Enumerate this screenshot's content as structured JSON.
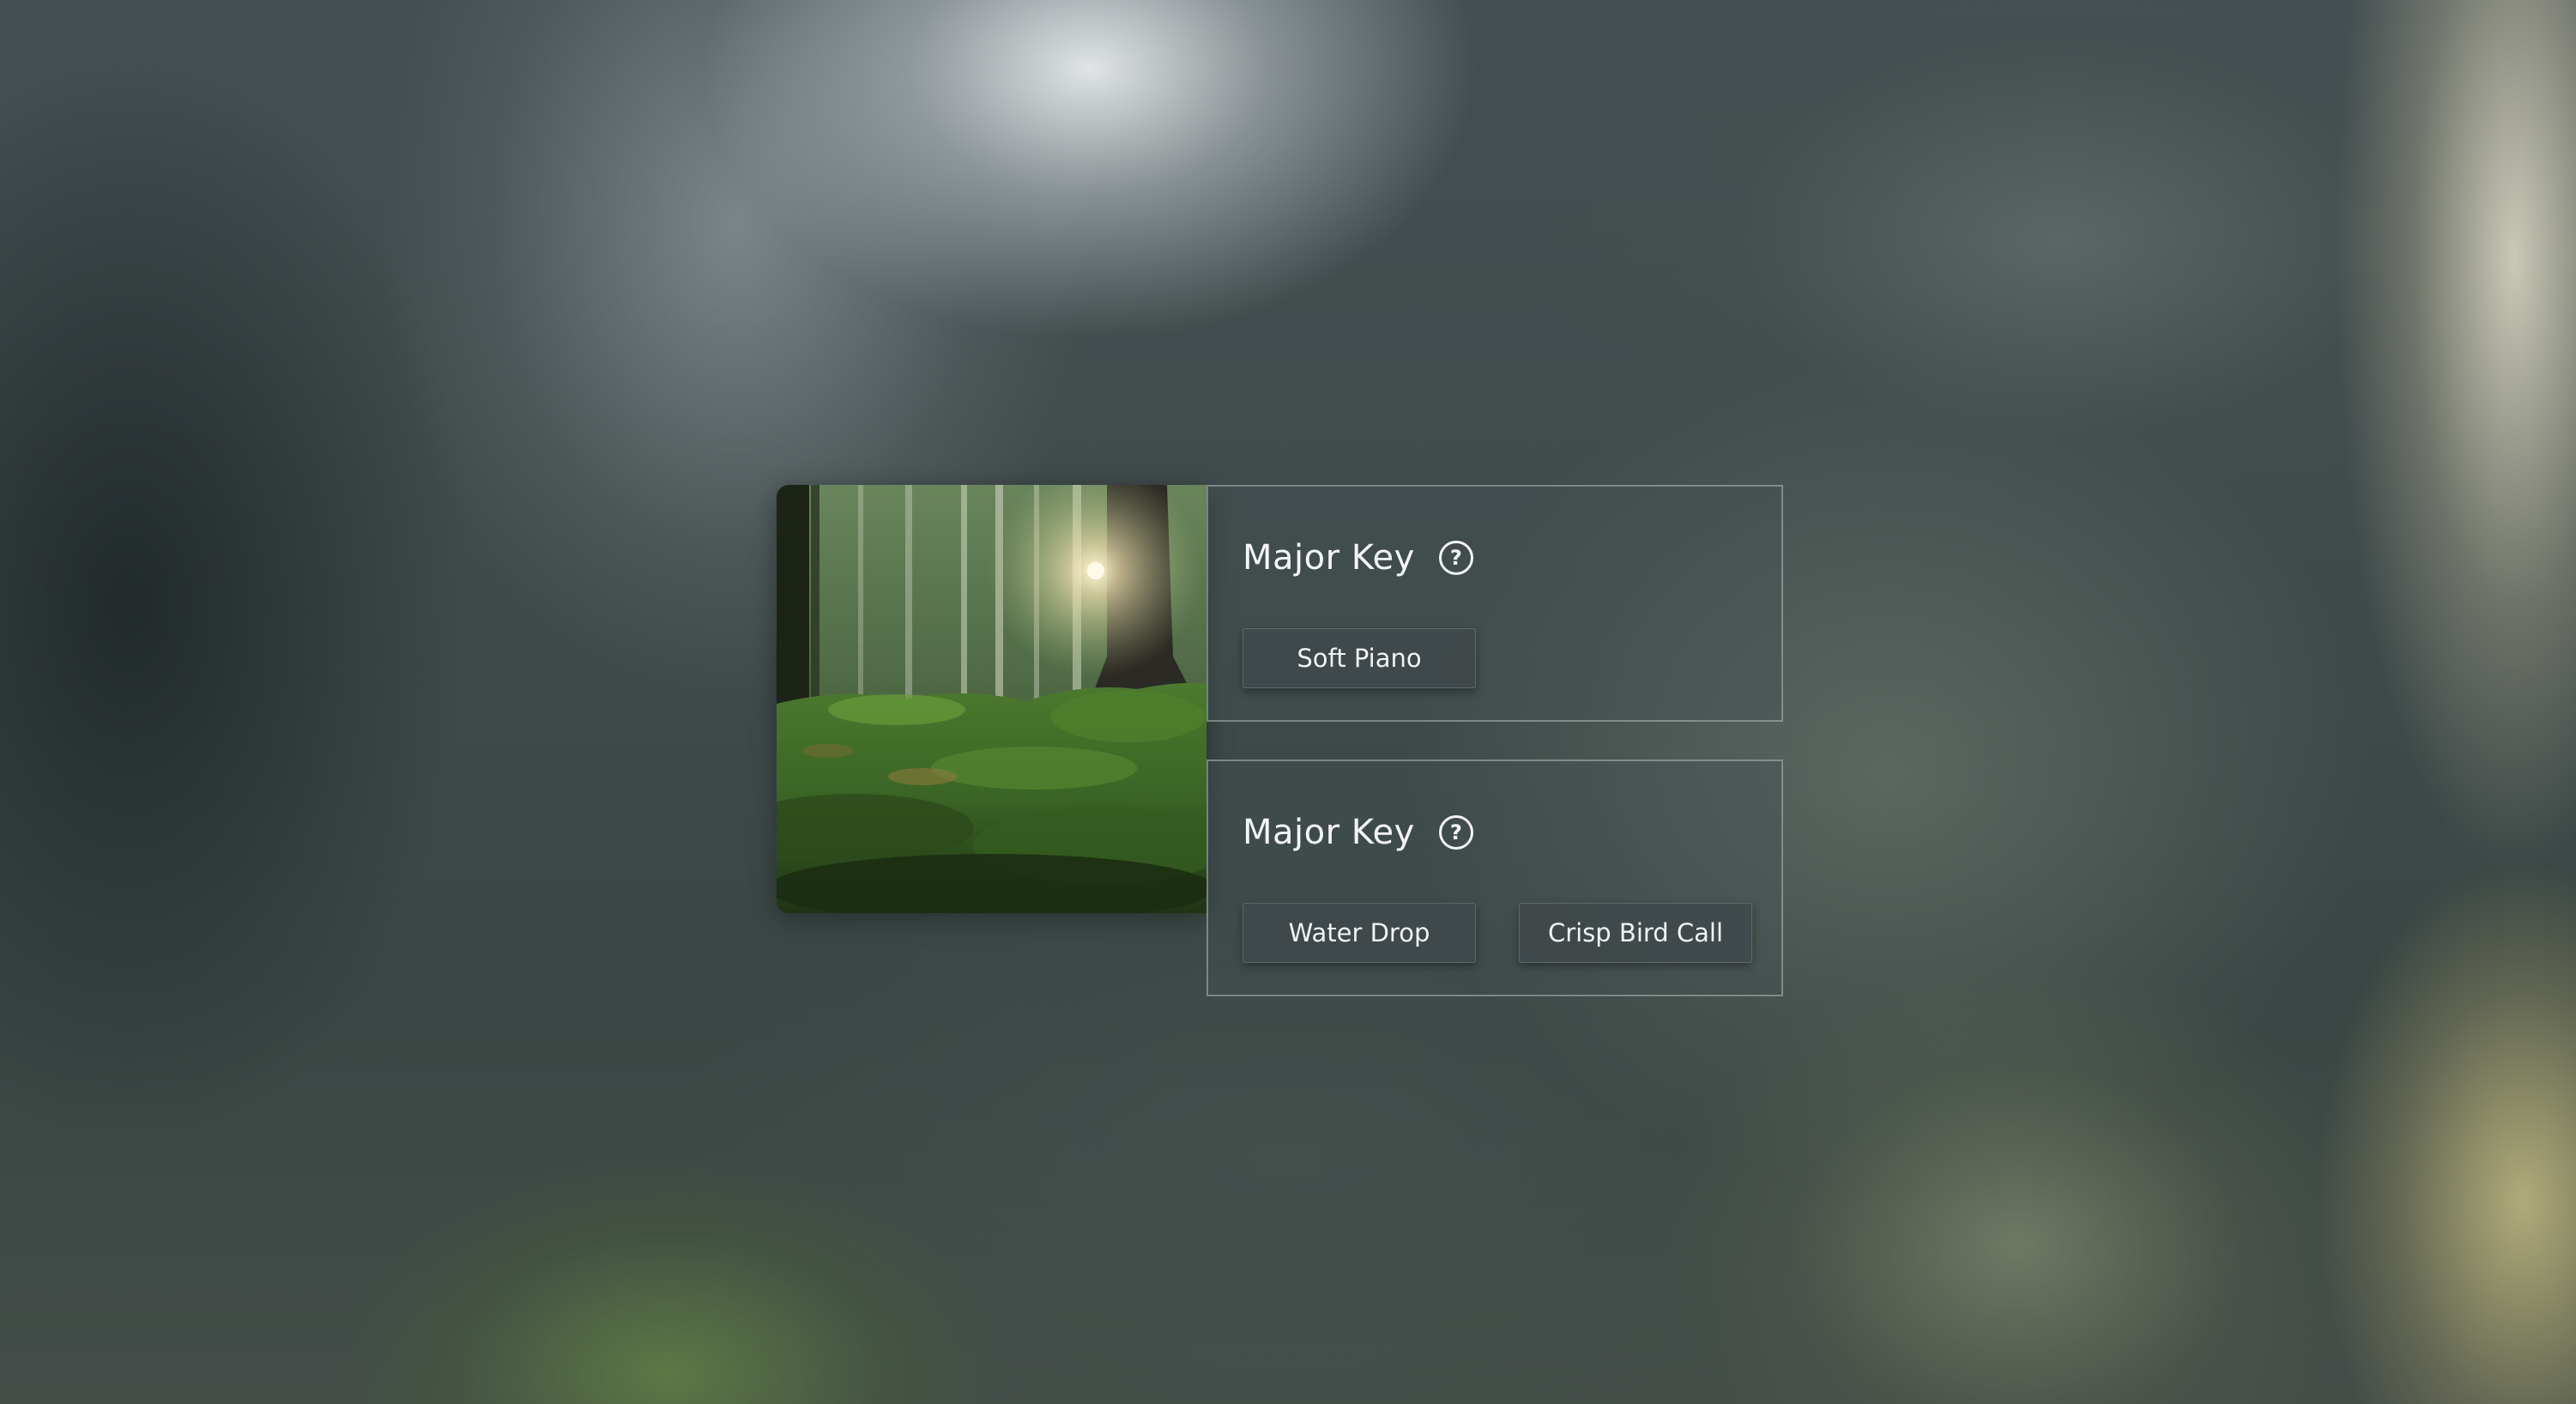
{
  "sections": [
    {
      "title": "Major Key",
      "help_icon": "help-circle-icon",
      "buttons": [
        {
          "label": "Soft Piano"
        }
      ]
    },
    {
      "title": "Major Key",
      "help_icon": "help-circle-icon",
      "buttons": [
        {
          "label": "Water Drop"
        },
        {
          "label": "Crisp Bird Call"
        }
      ]
    }
  ],
  "help_glyph": "?",
  "colors": {
    "panel_border": "#c8d0d0",
    "text": "#f3f5f5",
    "button_bg": "#40484a"
  }
}
